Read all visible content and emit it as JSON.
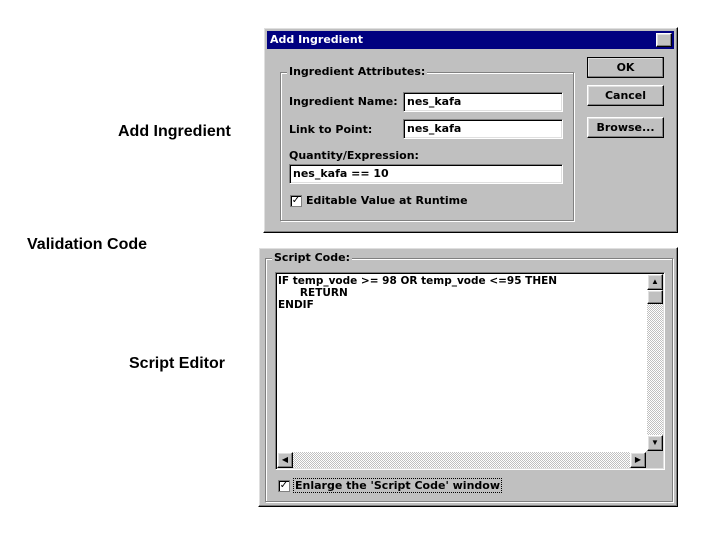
{
  "labels": {
    "add_ingredient": "Add Ingredient",
    "validation_code": "Validation Code",
    "script_editor": "Script Editor"
  },
  "dialog": {
    "title": "Add Ingredient",
    "close_glyph": "✕",
    "group_title": "Ingredient Attributes:",
    "ingredient_name_label": "Ingredient Name:",
    "ingredient_name_value": "nes_kafa",
    "link_to_point_label": "Link to Point:",
    "link_to_point_value": "nes_kafa",
    "quantity_label": "Quantity/Expression:",
    "quantity_value": "nes_kafa == 10",
    "editable_checkbox_label": "Editable Value at Runtime",
    "editable_checked": true,
    "ok_label": "OK",
    "cancel_label": "Cancel",
    "browse_label": "Browse..."
  },
  "editor": {
    "group_title": "Script Code:",
    "code": "IF temp_vode >= 98 OR temp_vode <=95 THEN\n      RETURN\nENDIF",
    "enlarge_label": "Enlarge the 'Script Code' window",
    "enlarge_checked": true
  },
  "icons": {
    "check": "✓",
    "up": "▲",
    "down": "▼",
    "left": "◀",
    "right": "▶"
  },
  "colors": {
    "titlebar": "#000080",
    "face": "#c0c0c0"
  }
}
